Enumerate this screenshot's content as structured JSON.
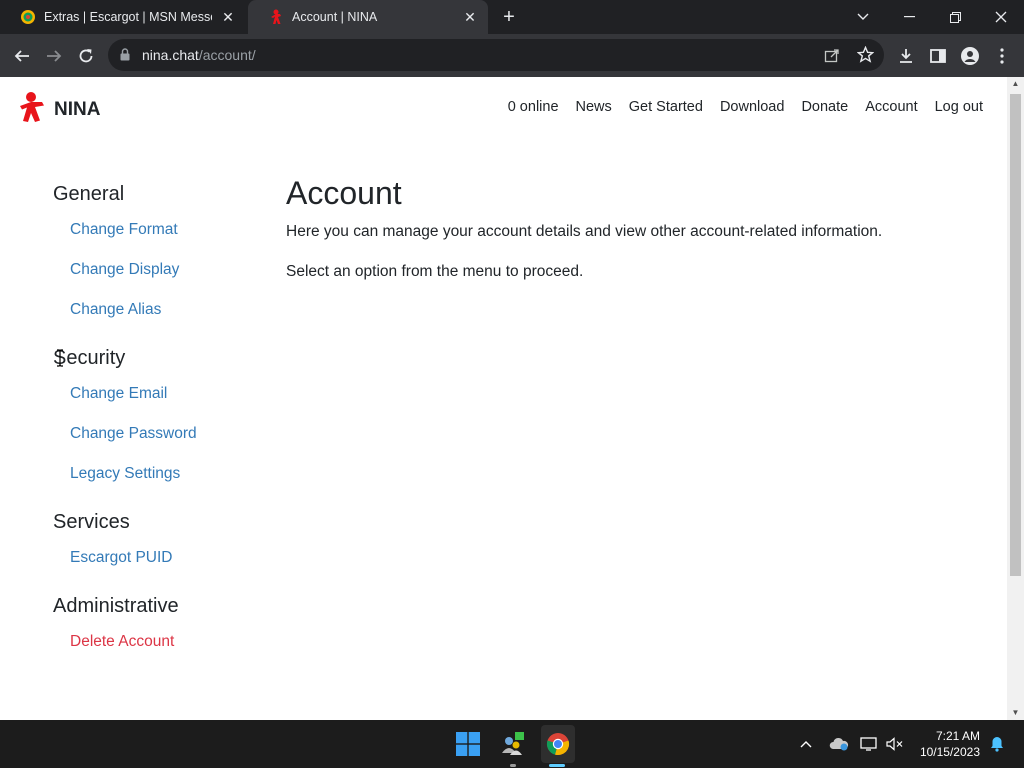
{
  "browser": {
    "tabs": [
      {
        "title": "Extras | Escargot | MSN Messeng",
        "active": false,
        "favicon": "escargot-icon"
      },
      {
        "title": "Account | NINA",
        "active": true,
        "favicon": "nina-icon"
      }
    ],
    "url_host": "nina.chat",
    "url_path": "/account/"
  },
  "site": {
    "brand": "NINA",
    "nav": [
      "0 online",
      "News",
      "Get Started",
      "Download",
      "Donate",
      "Account",
      "Log out"
    ]
  },
  "sidebar": {
    "sections": [
      {
        "heading": "General",
        "links": [
          "Change Format",
          "Change Display",
          "Change Alias"
        ]
      },
      {
        "heading": "Security",
        "links": [
          "Change Email",
          "Change Password",
          "Legacy Settings"
        ]
      },
      {
        "heading": "Services",
        "links": [
          "Escargot PUID"
        ]
      },
      {
        "heading": "Administrative",
        "links": [
          "Delete Account"
        ]
      }
    ]
  },
  "main": {
    "title": "Account",
    "paragraphs": [
      "Here you can manage your account details and view other account-related information.",
      "Select an option from the menu to proceed."
    ]
  },
  "taskbar": {
    "time": "7:21 AM",
    "date": "10/15/2023"
  },
  "colors": {
    "link": "#337ab7",
    "danger": "#dc3545",
    "brand_red": "#e8141b"
  }
}
